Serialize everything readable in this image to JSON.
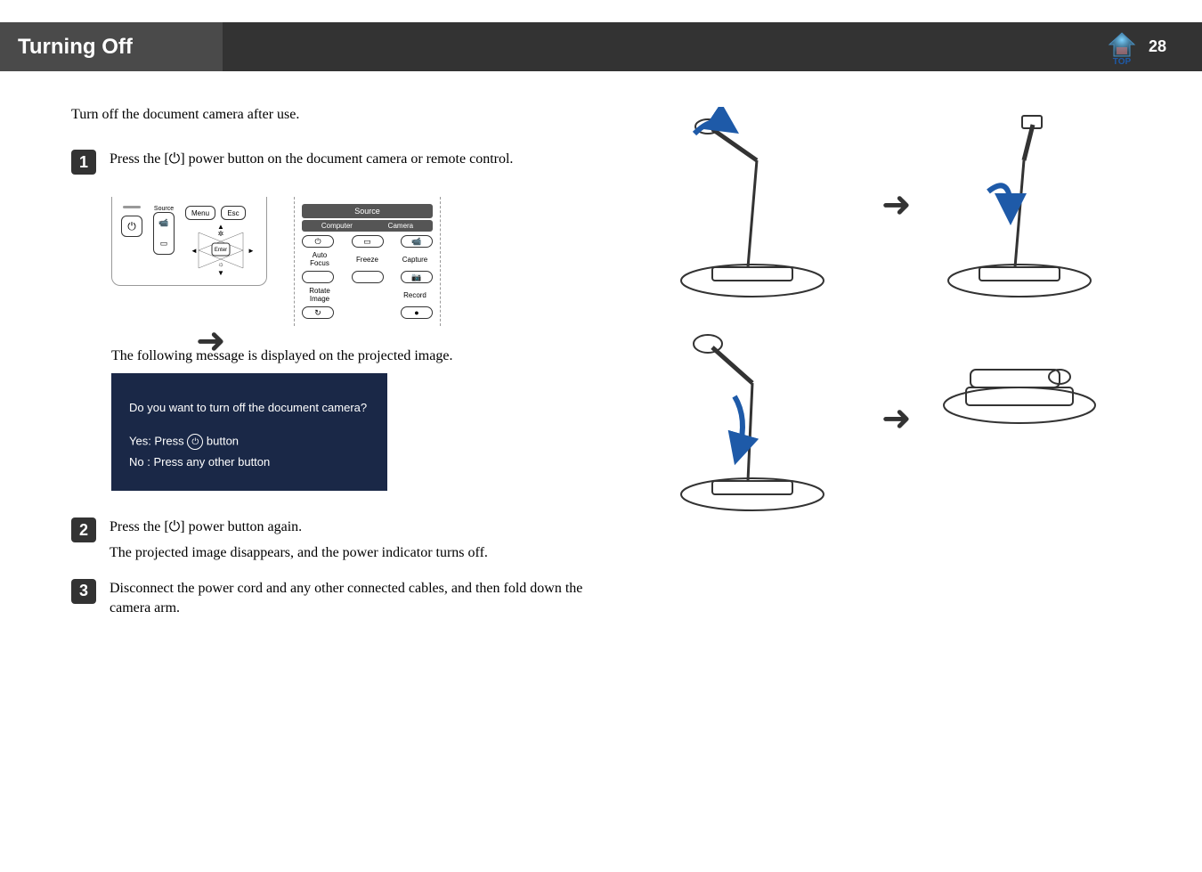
{
  "header": {
    "title": "Turning Off",
    "page_number": "28",
    "top_label": "TOP"
  },
  "intro": "Turn off the document camera after use.",
  "steps": [
    {
      "num": "1",
      "text_a": "Press the [",
      "text_b": "] power button on the document camera or remote control."
    },
    {
      "num": "2",
      "text": "Press the [⏻] power button again.",
      "sub": "The projected image disappears, and the power indicator turns off."
    },
    {
      "num": "3",
      "text": "Disconnect the power cord and any other connected cables, and then fold down the camera arm."
    }
  ],
  "control_panel": {
    "source_label": "Source",
    "menu": "Menu",
    "esc": "Esc",
    "enter": "Enter"
  },
  "remote": {
    "source_header": "Source",
    "computer": "Computer",
    "camera": "Camera",
    "auto_focus": "Auto Focus",
    "freeze": "Freeze",
    "capture": "Capture",
    "rotate_image": "Rotate Image",
    "record": "Record"
  },
  "message_intro": "The following message is displayed on the projected image.",
  "projector_message": {
    "question": "Do you want to turn off the document camera?",
    "yes_prefix": "Yes: Press ",
    "yes_suffix": " button",
    "no": "No : Press any other button"
  }
}
